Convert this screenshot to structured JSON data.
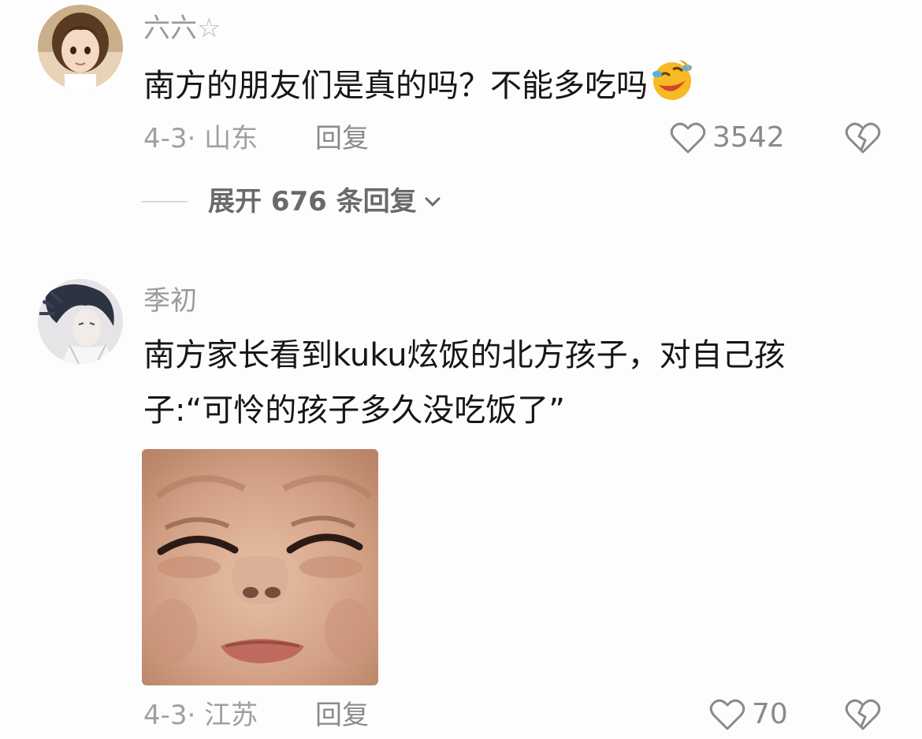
{
  "comments": [
    {
      "username": "六六",
      "username_suffix": "☆",
      "text": "南方的朋友们是真的吗？不能多吃吗",
      "emoji_icon": "rofl-emoji-icon",
      "date_location": "4-3· 山东",
      "reply_label": "回复",
      "like_count": "3542",
      "expand_replies_label": "展开 676 条回复"
    },
    {
      "username": "季初",
      "text_line1": "南方家长看到kuku炫饭的北方孩子，对自己孩",
      "text_line2": "子:“可怜的孩子多久没吃饭了”",
      "image_icon": "crying-child-meme",
      "date_location": "4-3· 江苏",
      "reply_label": "回复",
      "like_count": "70"
    }
  ],
  "colors": {
    "secondary_text": "#9a9a9a",
    "primary_text": "#161616",
    "background": "#fdfdfd"
  }
}
